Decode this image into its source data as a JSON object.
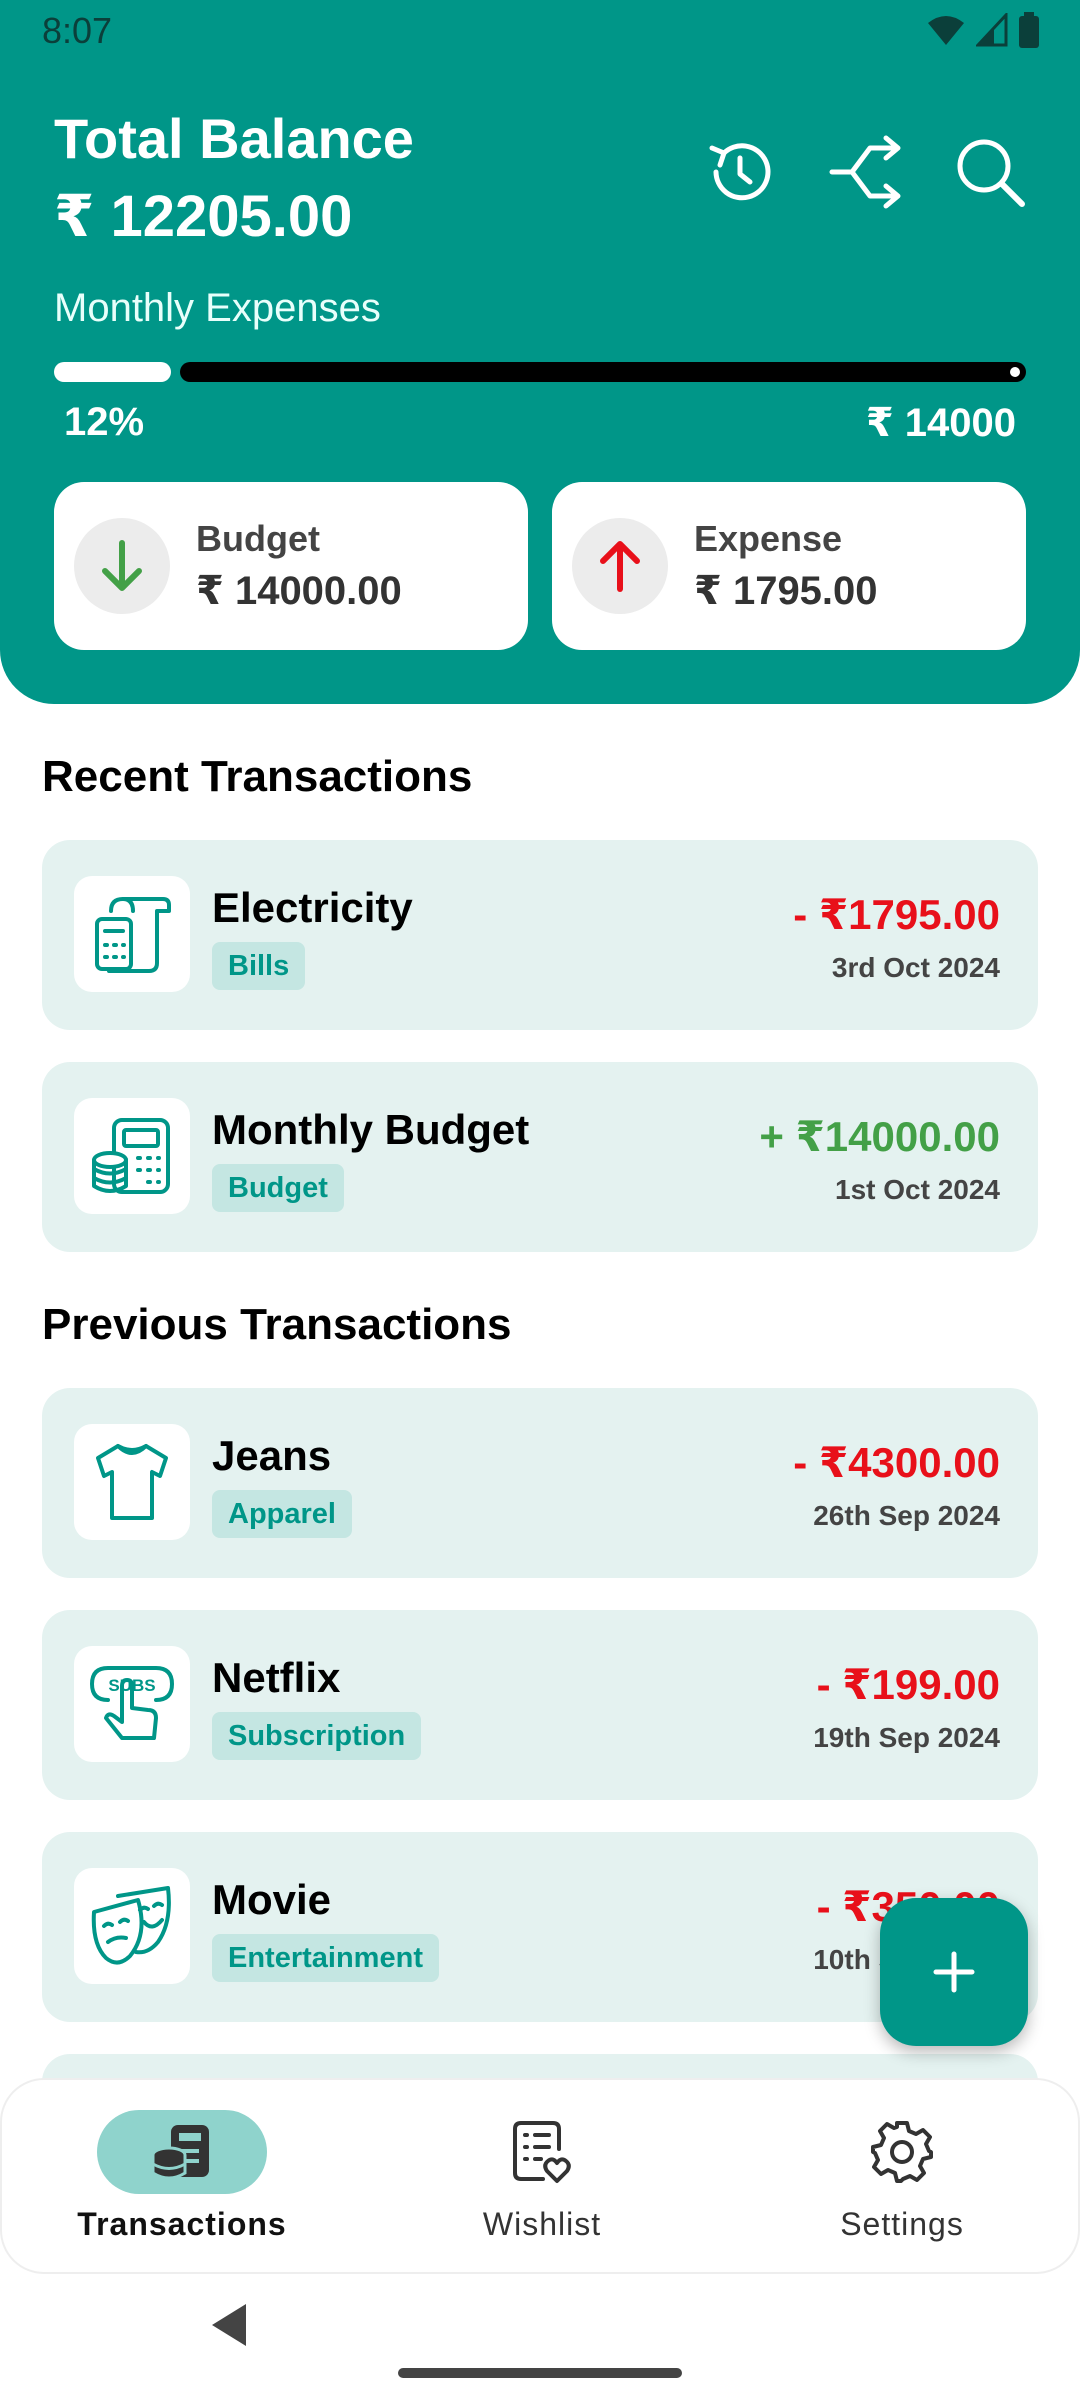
{
  "status_bar": {
    "time": "8:07"
  },
  "header": {
    "balance_label": "Total Balance",
    "balance_value": "₹ 12205.00",
    "icons": [
      "history-icon",
      "share-icon",
      "search-icon"
    ],
    "monthly_label": "Monthly Expenses",
    "progress_fraction": 0.12,
    "progress_percent": "12%",
    "progress_limit": "₹ 14000",
    "cards": [
      {
        "title": "Budget",
        "value": "₹ 14000.00",
        "icon": "arrow-down-icon"
      },
      {
        "title": "Expense",
        "value": "₹ 1795.00",
        "icon": "arrow-up-icon"
      }
    ]
  },
  "recent": {
    "title": "Recent Transactions",
    "items": [
      {
        "name": "Electricity",
        "tag": "Bills",
        "amount": "- ₹1795.00",
        "date": "3rd Oct 2024",
        "icon": "bill-icon"
      },
      {
        "name": "Monthly Budget",
        "tag": "Budget",
        "amount": "+ ₹14000.00",
        "date": "1st Oct 2024",
        "icon": "calculator-coins-icon"
      }
    ]
  },
  "previous": {
    "title": "Previous Transactions",
    "items": [
      {
        "name": "Jeans",
        "tag": "Apparel",
        "amount": "- ₹4300.00",
        "date": "26th Sep 2024",
        "icon": "tshirt-icon"
      },
      {
        "name": "Netflix",
        "tag": "Subscription",
        "amount": "- ₹199.00",
        "date": "19th Sep 2024",
        "icon": "subscription-icon"
      },
      {
        "name": "Movie",
        "tag": "Entertainment",
        "amount": "- ₹350.00",
        "date": "10th Sep 2024",
        "icon": "theater-masks-icon"
      }
    ]
  },
  "bottom_nav": {
    "items": [
      {
        "label": "Transactions",
        "icon": "transactions-icon",
        "active": true
      },
      {
        "label": "Wishlist",
        "icon": "wishlist-icon",
        "active": false
      },
      {
        "label": "Settings",
        "icon": "gear-icon",
        "active": false
      }
    ]
  },
  "colors": {
    "primary": "#009688",
    "negative": "#e8101a",
    "positive": "#43a047",
    "card_bg": "#e4f2f0",
    "tag_bg": "#c4e6e2",
    "nav_active": "#8fd3cc"
  }
}
